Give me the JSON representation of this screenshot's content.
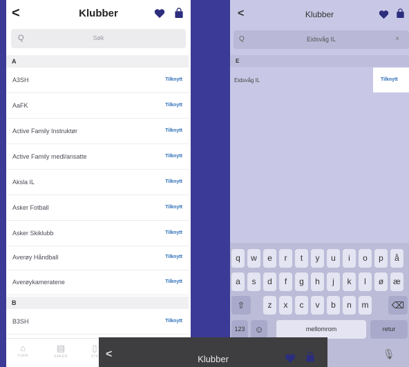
{
  "left": {
    "header": {
      "back": "<",
      "title": "Klubber"
    },
    "search": {
      "icon": "Q",
      "placeholder": "Søk"
    },
    "sections": [
      {
        "letter": "A",
        "items": [
          "A3SH",
          "AaFK",
          "Active Family Instruktør",
          "Active Family medl/ansatte",
          "Aksla IL",
          "Asker Fotball",
          "Asker Skiklubb",
          "Averøy Håndball",
          "Averøykameratene"
        ]
      },
      {
        "letter": "B",
        "items": [
          "B3SH"
        ]
      }
    ],
    "action_label": "Tilknytt",
    "tabs": [
      {
        "icon": "home-icon",
        "label": "HJEM"
      },
      {
        "icon": "stores-icon",
        "label": "SAKER"
      },
      {
        "icon": "stats-icon",
        "label": "STA"
      }
    ]
  },
  "right": {
    "header": {
      "back": "<",
      "title": "Klubber"
    },
    "search": {
      "icon": "Q",
      "value": "Eidsvåg IL",
      "clear": "×"
    },
    "section": "E",
    "result": {
      "name": "Eidsvåg IL",
      "action": "Tilknytt"
    },
    "keyboard": {
      "row1": [
        "q",
        "w",
        "e",
        "r",
        "t",
        "y",
        "u",
        "i",
        "o",
        "p",
        "å"
      ],
      "row2": [
        "a",
        "s",
        "d",
        "f",
        "g",
        "h",
        "j",
        "k",
        "l",
        "ø",
        "æ"
      ],
      "row3": [
        "z",
        "x",
        "c",
        "v",
        "b",
        "n",
        "m"
      ],
      "shift": "⇧",
      "backspace": "⌫",
      "numbers": "123",
      "emoji": "☺",
      "space": "mellomrom",
      "return": "retur",
      "mic": "🎙"
    }
  },
  "overlay": {
    "back": "<",
    "title": "Klubber"
  },
  "colors": {
    "accent": "#2d2d7e",
    "link": "#2d6fb8",
    "background": "#3b3a96"
  }
}
